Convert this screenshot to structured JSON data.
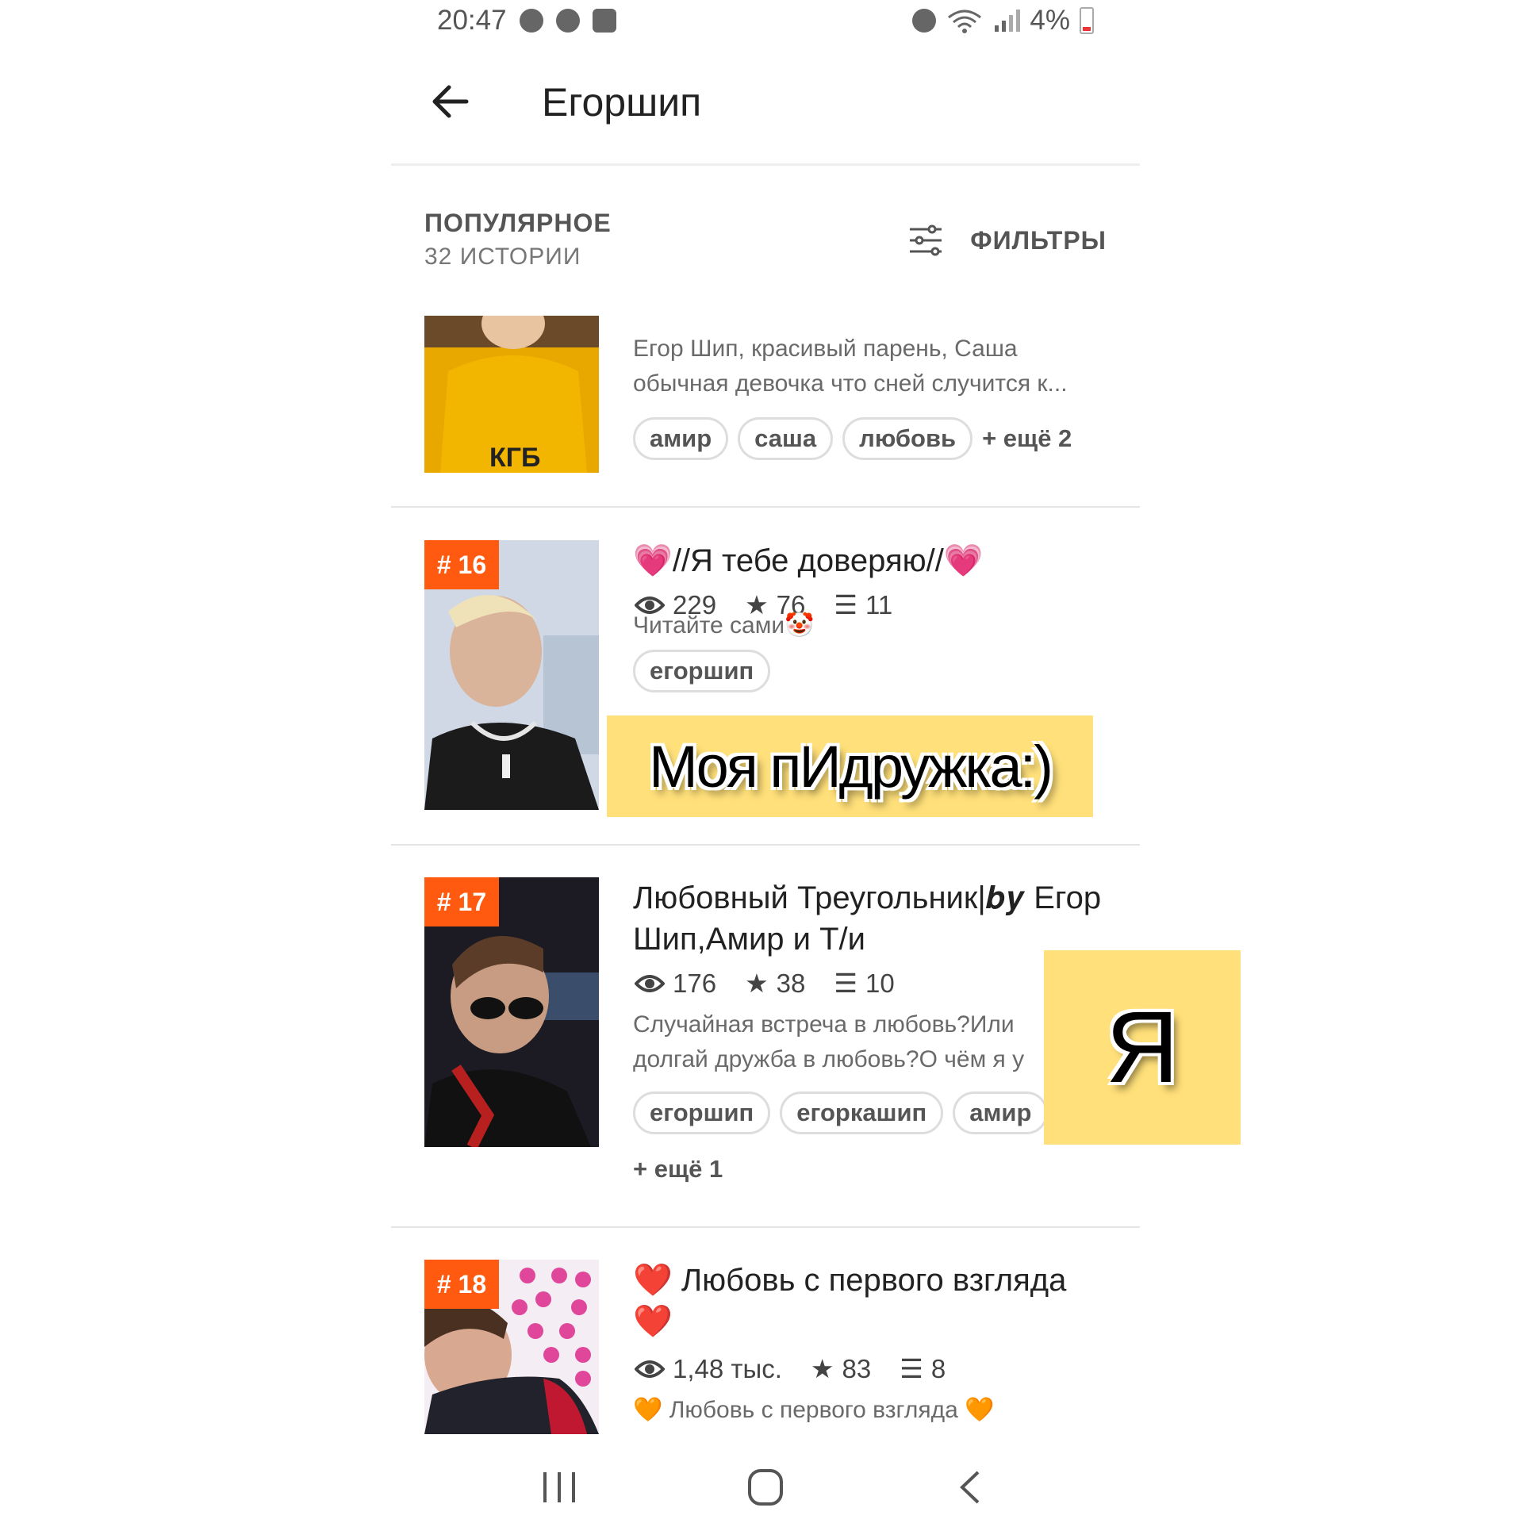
{
  "status_bar": {
    "time": "20:47",
    "battery": "4%"
  },
  "app_bar": {
    "back_icon": "arrow-left-icon",
    "title": "Егоршип"
  },
  "section": {
    "title": "ПОПУЛЯРНОЕ",
    "count": "32 ИСТОРИИ",
    "filters_label": "ФИЛЬТРЫ"
  },
  "stories": [
    {
      "description": "Егор Шип, красивый парень, Саша обычная девочка что сней случится к...",
      "tags": [
        "амир",
        "саша",
        "любовь"
      ],
      "more": "+ ещё 2"
    },
    {
      "rank": "# 16",
      "title": "//Я тебе доверяю//",
      "views": "229",
      "stars": "76",
      "parts": "11",
      "description": "Читайте сами🤡",
      "tags": [
        "егоршип"
      ]
    },
    {
      "rank": "# 17",
      "title": "Любовный Треугольник|𝒃𝒚 Егор Шип,Амир и Т/и",
      "views": "176",
      "stars": "38",
      "parts": "10",
      "description": "Случайная встреча в любовь?Или долгай дружба в любовь?О чём я у",
      "tags": [
        "егоршип",
        "егоркашип",
        "амир"
      ],
      "more": "+ ещё 1"
    },
    {
      "rank": "# 18",
      "title": "❤️ Любовь с первого взгляда ❤️",
      "views": "1,48 тыс.",
      "stars": "83",
      "parts": "8",
      "description": "🧡 Любовь с первого взгляда 🧡"
    }
  ],
  "stickers": {
    "friend": "Моя пИдружка:)",
    "me": "Я"
  },
  "colors": {
    "badge": "#ff5a10",
    "sticker": "#ffe07a"
  }
}
